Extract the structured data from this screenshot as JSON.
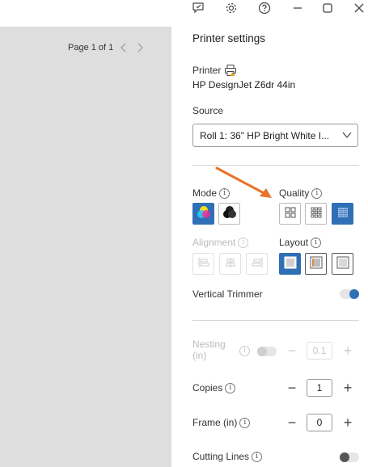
{
  "pager": {
    "label": "Page 1 of 1"
  },
  "panel": {
    "title": "Printer settings",
    "printer": {
      "label": "Printer",
      "name": "HP DesignJet Z6dr 44in"
    },
    "source": {
      "label": "Source",
      "value": "Roll 1: 36\" HP Bright White I..."
    },
    "mode": {
      "label": "Mode",
      "info": "i"
    },
    "quality": {
      "label": "Quality",
      "info": "i"
    },
    "alignment": {
      "label": "Alignment",
      "info": "i"
    },
    "layout": {
      "label": "Layout",
      "info": "i"
    },
    "vertical_trimmer": {
      "label": "Vertical Trimmer",
      "on": true
    },
    "nesting": {
      "label_line1": "Nesting",
      "label_line2": "(in)",
      "info": "i",
      "value": "0.1"
    },
    "copies": {
      "label": "Copies",
      "info": "i",
      "value": "1"
    },
    "frame": {
      "label": "Frame (in)",
      "info": "i",
      "value": "0"
    },
    "cutting_lines": {
      "label": "Cutting Lines",
      "info": "i",
      "on": false
    }
  },
  "colors": {
    "accent": "#2f6fb5",
    "arrow": "#e8742a",
    "preview_bg": "#dedede"
  }
}
